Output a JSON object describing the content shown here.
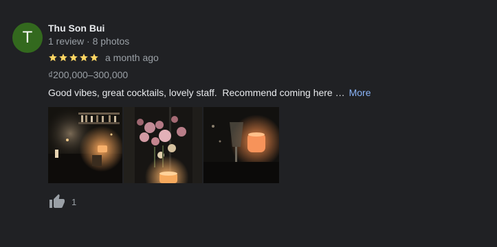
{
  "reviewer": {
    "initial": "T",
    "name": "Thu Son Bui",
    "meta": "1 review · 8 photos",
    "avatar_color": "#33691e"
  },
  "rating": {
    "stars": 5,
    "max": 5,
    "date": "a month ago",
    "star_color": "#fdd663"
  },
  "price": "₫200,000–300,000",
  "review_text": "Good vibes, great cocktails, lovely staff.  Recommend coming here …",
  "more_label": "More",
  "photos": [
    {
      "icon": "bar-interior-photo"
    },
    {
      "icon": "flowers-candle-photo"
    },
    {
      "icon": "candle-glass-photo"
    }
  ],
  "likes": {
    "count": "1",
    "icon": "thumbs-up-icon"
  }
}
